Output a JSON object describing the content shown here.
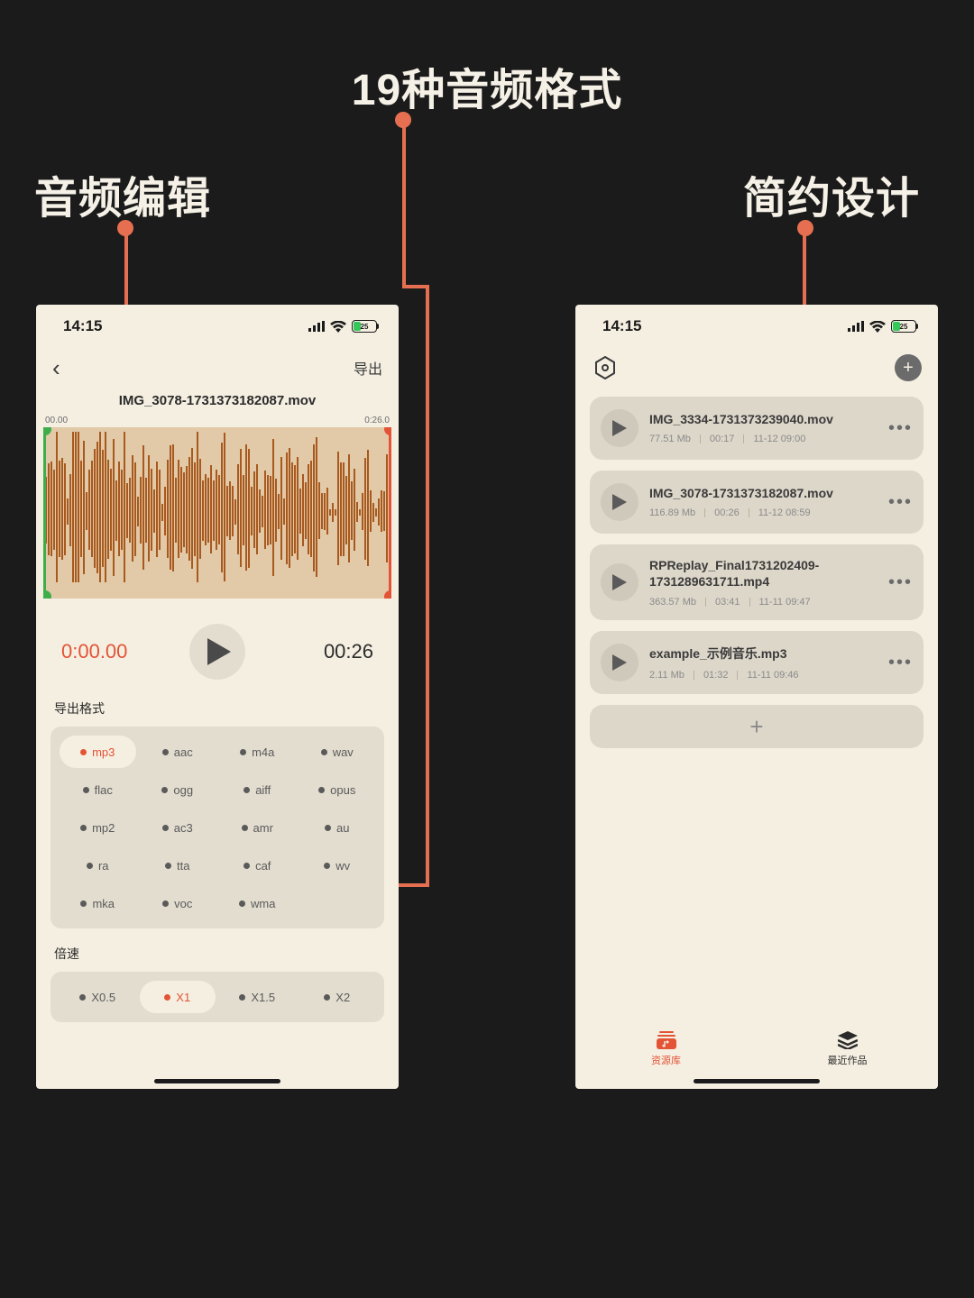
{
  "callouts": {
    "top": "19种音频格式",
    "left": "音频编辑",
    "right": "简约设计"
  },
  "status": {
    "time": "14:15",
    "battery": "25"
  },
  "editor": {
    "export_label": "导出",
    "filename": "IMG_3078-1731373182087.mov",
    "ruler_start": "00.00",
    "ruler_end": "0:26.0",
    "current_time": "0:00.00",
    "duration": "00:26",
    "format_section": "导出格式",
    "formats": [
      "mp3",
      "aac",
      "m4a",
      "wav",
      "flac",
      "ogg",
      "aiff",
      "opus",
      "mp2",
      "ac3",
      "amr",
      "au",
      "ra",
      "tta",
      "caf",
      "wv",
      "mka",
      "voc",
      "wma"
    ],
    "format_selected": "mp3",
    "speed_section": "倍速",
    "speeds": [
      "X0.5",
      "X1",
      "X1.5",
      "X2"
    ],
    "speed_selected": "X1"
  },
  "library": {
    "files": [
      {
        "name": "IMG_3334-1731373239040.mov",
        "size": "77.51 Mb",
        "dur": "00:17",
        "date": "11-12 09:00"
      },
      {
        "name": "IMG_3078-1731373182087.mov",
        "size": "116.89 Mb",
        "dur": "00:26",
        "date": "11-12 08:59"
      },
      {
        "name": "RPReplay_Final1731202409-1731289631711.mp4",
        "size": "363.57 Mb",
        "dur": "03:41",
        "date": "11-11 09:47"
      },
      {
        "name": "example_示例音乐.mp3",
        "size": "2.11 Mb",
        "dur": "01:32",
        "date": "11-11 09:46"
      }
    ],
    "tabs": {
      "library": "资源库",
      "recent": "最近作品"
    }
  },
  "colors": {
    "accent": "#e35336"
  }
}
